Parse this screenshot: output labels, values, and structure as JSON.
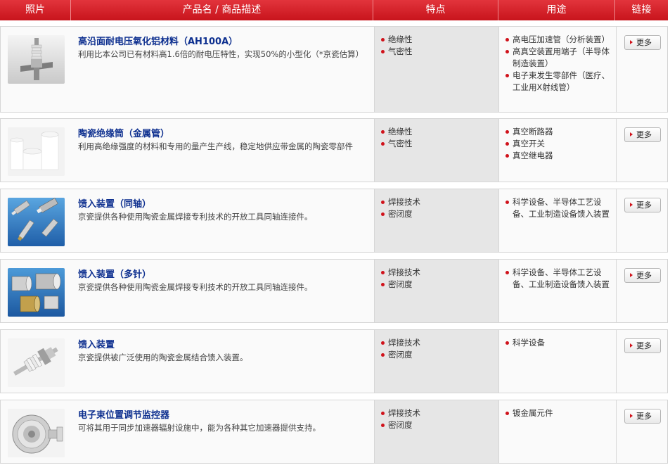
{
  "header": {
    "photo": "照片",
    "name": "产品名 / 商品描述",
    "features": "特点",
    "uses": "用途",
    "link": "链接"
  },
  "products": [
    {
      "title": "高沿面耐电压氧化铝材料（AH100A）",
      "desc": "利用比本公司已有材料高1.6倍的耐电压特性，实现50%的小型化（*京瓷估算）",
      "features": [
        "绝缘性",
        "气密性"
      ],
      "uses": [
        "高电压加速管（分析装置）",
        "高真空装置用端子（半导体制造装置）",
        "电子束发生零部件（医疗、工业用X射线管）"
      ],
      "more": "更多"
    },
    {
      "title": "陶瓷绝缘筒（金属管）",
      "desc": "利用高绝缘强度的材料和专用的量产生产线，稳定地供应带金属的陶瓷零部件",
      "features": [
        "绝缘性",
        "气密性"
      ],
      "uses": [
        "真空断路器",
        "真空开关",
        "真空继电器"
      ],
      "more": "更多"
    },
    {
      "title": "馈入装置（同轴）",
      "desc": "京瓷提供各种使用陶瓷金属焊接专利技术的开放工具同轴连接件。",
      "features": [
        "焊接技术",
        "密闭度"
      ],
      "uses": [
        "科学设备、半导体工艺设备、工业制造设备馈入装置"
      ],
      "more": "更多"
    },
    {
      "title": "馈入装置（多针）",
      "desc": "京瓷提供各种使用陶瓷金属焊接专利技术的开放工具同轴连接件。",
      "features": [
        "焊接技术",
        "密闭度"
      ],
      "uses": [
        "科学设备、半导体工艺设备、工业制造设备馈入装置"
      ],
      "more": "更多"
    },
    {
      "title": "馈入装置",
      "desc": "京瓷提供被广泛使用的陶瓷金属结合馈入装置。",
      "features": [
        "焊接技术",
        "密闭度"
      ],
      "uses": [
        "科学设备"
      ],
      "more": "更多"
    },
    {
      "title": "电子束位置调节监控器",
      "desc": "可将其用于同步加速器辐射设施中，能为各种其它加速器提供支持。",
      "features": [
        "焊接技术",
        "密闭度"
      ],
      "uses": [
        "镀金属元件"
      ],
      "more": "更多"
    }
  ]
}
